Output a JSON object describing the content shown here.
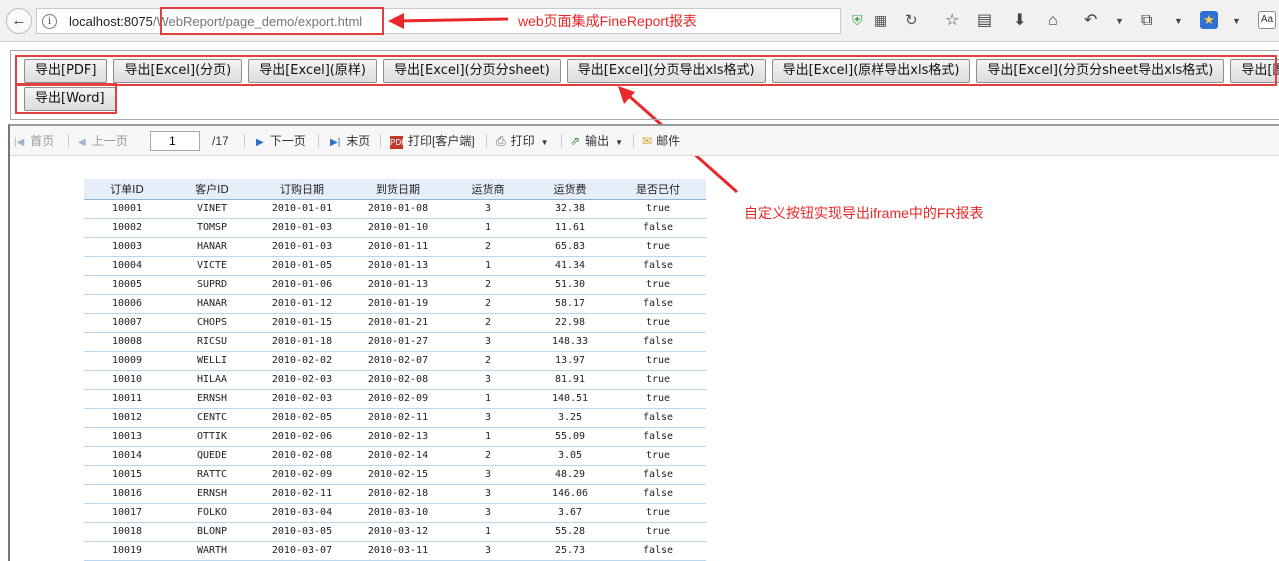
{
  "browser": {
    "url_host": "localhost:8075",
    "url_path": "/WebReport/page_demo/export.html"
  },
  "annotations": {
    "url_note": "web页面集成FineReport报表",
    "button_note": "自定义按钮实现导出iframe中的FR报表"
  },
  "accent_color": "#e8282a",
  "export_buttons": [
    "导出[PDF]",
    "导出[Excel](分页)",
    "导出[Excel](原样)",
    "导出[Excel](分页分sheet)",
    "导出[Excel](分页导出xls格式)",
    "导出[Excel](原样导出xls格式)",
    "导出[Excel](分页分sheet导出xls格式)",
    "导出[图片]",
    "导出[Word]"
  ],
  "report_toolbar": {
    "first": "首页",
    "prev": "上一页",
    "page_current": "1",
    "page_total": "/17",
    "next": "下一页",
    "last": "末页",
    "print_client": "打印[客户端]",
    "print": "打印",
    "output": "输出",
    "mail": "邮件"
  },
  "table": {
    "headers": [
      "订单ID",
      "客户ID",
      "订购日期",
      "到货日期",
      "运货商",
      "运货费",
      "是否已付"
    ],
    "rows": [
      [
        "10001",
        "VINET",
        "2010-01-01",
        "2010-01-08",
        "3",
        "32.38",
        "true"
      ],
      [
        "10002",
        "TOMSP",
        "2010-01-03",
        "2010-01-10",
        "1",
        "11.61",
        "false"
      ],
      [
        "10003",
        "HANAR",
        "2010-01-03",
        "2010-01-11",
        "2",
        "65.83",
        "true"
      ],
      [
        "10004",
        "VICTE",
        "2010-01-05",
        "2010-01-13",
        "1",
        "41.34",
        "false"
      ],
      [
        "10005",
        "SUPRD",
        "2010-01-06",
        "2010-01-13",
        "2",
        "51.30",
        "true"
      ],
      [
        "10006",
        "HANAR",
        "2010-01-12",
        "2010-01-19",
        "2",
        "58.17",
        "false"
      ],
      [
        "10007",
        "CHOPS",
        "2010-01-15",
        "2010-01-21",
        "2",
        "22.98",
        "true"
      ],
      [
        "10008",
        "RICSU",
        "2010-01-18",
        "2010-01-27",
        "3",
        "148.33",
        "false"
      ],
      [
        "10009",
        "WELLI",
        "2010-02-02",
        "2010-02-07",
        "2",
        "13.97",
        "true"
      ],
      [
        "10010",
        "HILAA",
        "2010-02-03",
        "2010-02-08",
        "3",
        "81.91",
        "true"
      ],
      [
        "10011",
        "ERNSH",
        "2010-02-03",
        "2010-02-09",
        "1",
        "140.51",
        "true"
      ],
      [
        "10012",
        "CENTC",
        "2010-02-05",
        "2010-02-11",
        "3",
        "3.25",
        "false"
      ],
      [
        "10013",
        "OTTIK",
        "2010-02-06",
        "2010-02-13",
        "1",
        "55.09",
        "false"
      ],
      [
        "10014",
        "QUEDE",
        "2010-02-08",
        "2010-02-14",
        "2",
        "3.05",
        "true"
      ],
      [
        "10015",
        "RATTC",
        "2010-02-09",
        "2010-02-15",
        "3",
        "48.29",
        "false"
      ],
      [
        "10016",
        "ERNSH",
        "2010-02-11",
        "2010-02-18",
        "3",
        "146.06",
        "false"
      ],
      [
        "10017",
        "FOLKO",
        "2010-03-04",
        "2010-03-10",
        "3",
        "3.67",
        "true"
      ],
      [
        "10018",
        "BLONP",
        "2010-03-05",
        "2010-03-12",
        "1",
        "55.28",
        "true"
      ],
      [
        "10019",
        "WARTH",
        "2010-03-07",
        "2010-03-11",
        "3",
        "25.73",
        "false"
      ]
    ]
  }
}
